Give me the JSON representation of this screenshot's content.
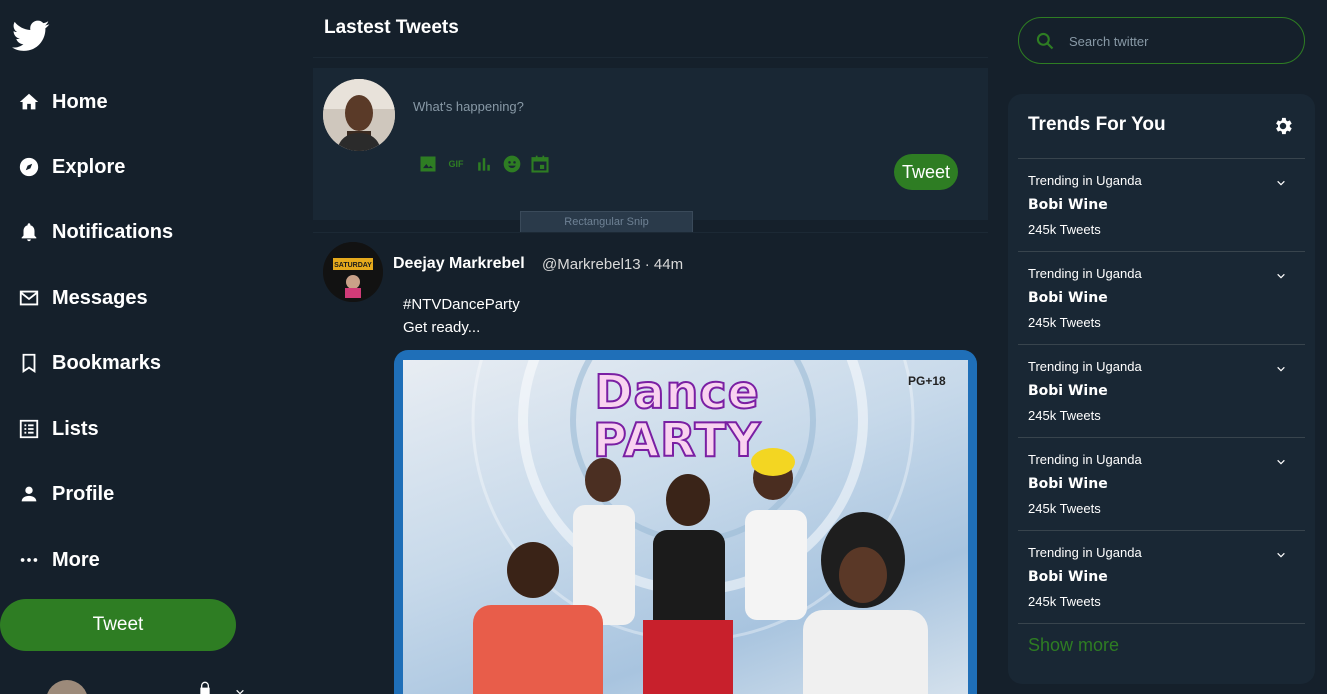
{
  "sidebar": {
    "logo_icon": "twitter-bird-icon",
    "items": [
      {
        "label": "Home",
        "icon": "home-icon"
      },
      {
        "label": "Explore",
        "icon": "compass-icon"
      },
      {
        "label": "Notifications",
        "icon": "bell-icon"
      },
      {
        "label": "Messages",
        "icon": "envelope-icon"
      },
      {
        "label": "Bookmarks",
        "icon": "bookmark-icon"
      },
      {
        "label": "Lists",
        "icon": "list-icon"
      },
      {
        "label": "Profile",
        "icon": "person-icon"
      },
      {
        "label": "More",
        "icon": "more-dots-icon"
      }
    ],
    "tweet_button": "Tweet"
  },
  "main": {
    "title": "Lastest Tweets",
    "compose": {
      "placeholder": "What's happening?",
      "tools": [
        "image-icon",
        "gif-icon",
        "poll-icon",
        "emoji-icon",
        "schedule-icon"
      ],
      "gif_text": "GIF",
      "tweet_button": "Tweet"
    },
    "snip_overlay": "Rectangular Snip",
    "tweet": {
      "name": "Deejay Markrebel",
      "handle": "@Markrebel13 · 44m",
      "line1": "#NTVDanceParty",
      "line2": "Get ready...",
      "avatar_text": "SATURDAY",
      "media": {
        "title_line1": "Dance",
        "title_line2": "PARTY",
        "rating": "PG+18"
      }
    }
  },
  "search": {
    "placeholder": "Search twitter"
  },
  "trends": {
    "title": "Trends For You",
    "items": [
      {
        "meta": "Trending in Uganda",
        "name": "Bobi Wine",
        "count": "245k Tweets"
      },
      {
        "meta": "Trending in Uganda",
        "name": "Bobi Wine",
        "count": "245k Tweets"
      },
      {
        "meta": "Trending in Uganda",
        "name": "Bobi Wine",
        "count": "245k Tweets"
      },
      {
        "meta": "Trending in Uganda",
        "name": "Bobi Wine",
        "count": "245k Tweets"
      },
      {
        "meta": "Trending in Uganda",
        "name": "Bobi Wine",
        "count": "245k Tweets"
      }
    ],
    "show_more": "Show more"
  },
  "colors": {
    "background": "#15202b",
    "panel": "#192734",
    "accent": "#2e7d23",
    "muted_text": "#8899a6"
  }
}
